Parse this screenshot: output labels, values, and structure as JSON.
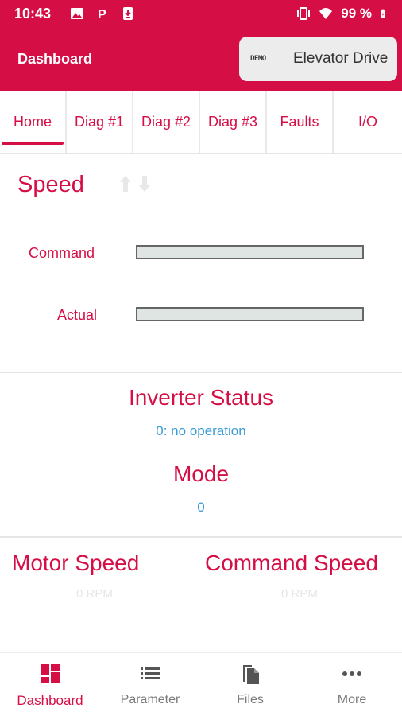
{
  "status_bar": {
    "time": "10:43",
    "battery_text": "99 %",
    "icons": [
      "image-icon",
      "parking-icon",
      "download-icon",
      "vibrate-icon",
      "wifi-icon",
      "battery-icon"
    ]
  },
  "app_bar": {
    "title": "Dashboard",
    "device_chip": {
      "logo_text": "DEMO",
      "name": "Elevator Drive"
    }
  },
  "tabs": [
    {
      "label": "Home",
      "active": true
    },
    {
      "label": "Diag #1",
      "active": false
    },
    {
      "label": "Diag #2",
      "active": false
    },
    {
      "label": "Diag #3",
      "active": false
    },
    {
      "label": "Faults",
      "active": false
    },
    {
      "label": "I/O",
      "active": false
    }
  ],
  "speed": {
    "title": "Speed",
    "rows": [
      {
        "label": "Command",
        "fill_fraction": 0
      },
      {
        "label": "Actual",
        "fill_fraction": 0
      }
    ]
  },
  "inverter_status": {
    "title": "Inverter Status",
    "value": "0: no operation"
  },
  "mode": {
    "title": "Mode",
    "value": "0"
  },
  "metrics": {
    "motor_speed": {
      "title": "Motor Speed",
      "value": "0 RPM"
    },
    "command_speed": {
      "title": "Command Speed",
      "value": "0 RPM"
    }
  },
  "bottom_nav": [
    {
      "label": "Dashboard",
      "icon": "dashboard-icon",
      "active": true
    },
    {
      "label": "Parameter",
      "icon": "list-icon",
      "active": false
    },
    {
      "label": "Files",
      "icon": "files-icon",
      "active": false
    },
    {
      "label": "More",
      "icon": "more-icon",
      "active": false
    }
  ],
  "colors": {
    "brand": "#d50f46",
    "value_blue": "#3b9bd6",
    "chip_bg": "#ececec"
  }
}
